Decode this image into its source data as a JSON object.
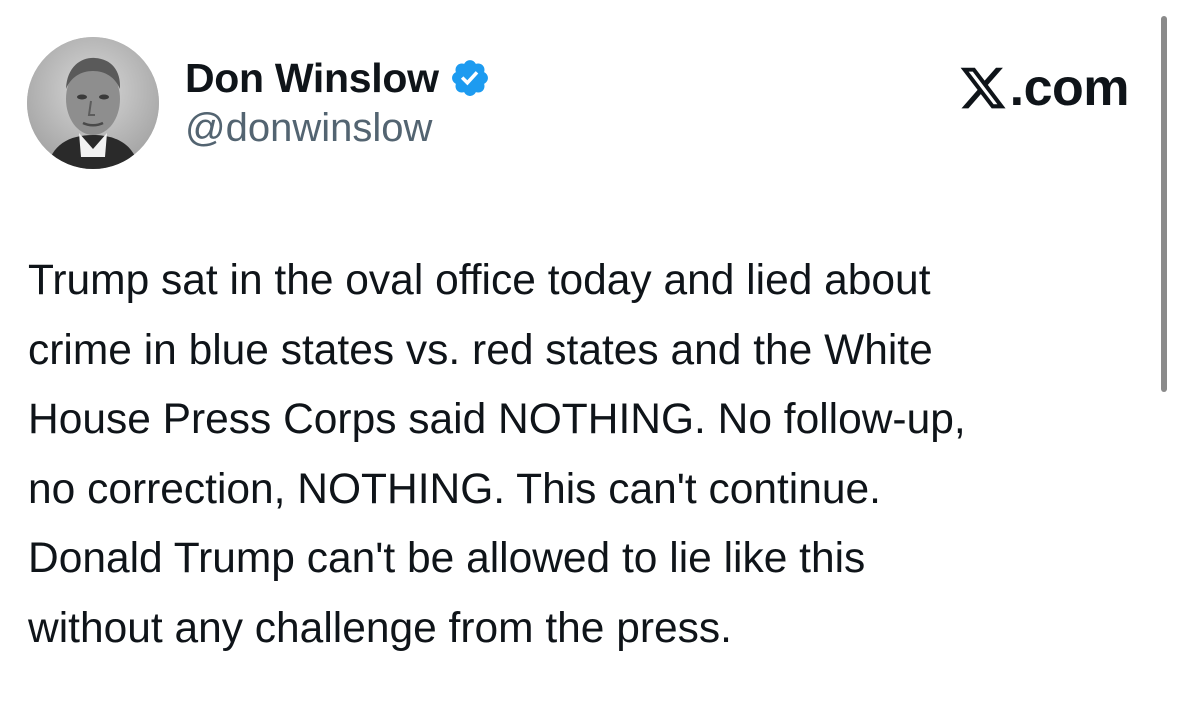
{
  "author": {
    "display_name": "Don Winslow",
    "handle": "@donwinslow",
    "verified": true,
    "verified_color": "#1d9bf0",
    "avatar_icon": "author-photo-avatar"
  },
  "brand": {
    "logo_icon": "x-logo-icon",
    "text": ".com"
  },
  "tweet": {
    "lines": [
      "Trump sat in the oval office today and lied about",
      "crime in blue states vs. red states and the White",
      "House Press Corps said NOTHING. No follow-up,",
      "no correction, NOTHING. This can't continue.",
      "Donald Trump can't be allowed to lie like this",
      "without any challenge from the press."
    ]
  },
  "colors": {
    "text_primary": "#0f1419",
    "text_secondary": "#536471",
    "background": "#ffffff"
  }
}
